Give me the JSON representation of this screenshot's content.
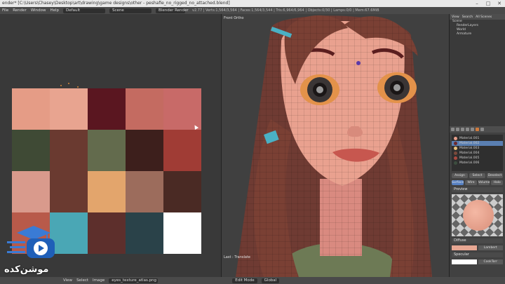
{
  "window": {
    "title": "ender* [C:\\Users\\Chasey\\Desktop\\art\\drawing\\game designs\\other - peshafie_no_rigged_no_attached.blend]"
  },
  "menubar": {
    "items": [
      "File",
      "Render",
      "Window",
      "Help"
    ],
    "layout_value": "Default",
    "scene_value": "Scene",
    "engine_value": "Blender Render",
    "stats": "v2.77 | Verts:1,564/3,564 | Faces:1,564/3,544 | Tris:6,964/6,964 | Objects:0/30 | Lamps:0/0 | Mem:67.6MiB"
  },
  "viewport": {
    "label": "Front Ortho",
    "last_operator": "Last : Translate"
  },
  "outliner": {
    "header": [
      "View",
      "Search",
      "All Scenes"
    ],
    "rows": [
      {
        "label": "Scene",
        "indent": 0
      },
      {
        "label": "RenderLayers",
        "indent": 1
      },
      {
        "label": "World",
        "indent": 1
      },
      {
        "label": "Armature",
        "indent": 1
      }
    ]
  },
  "properties": {
    "materials": [
      {
        "name": "Material.001",
        "color": "#e79e8b",
        "selected": false
      },
      {
        "name": "Material.002",
        "color": "#6d2a2d",
        "selected": true
      },
      {
        "name": "Material.003",
        "color": "#e7c07b",
        "selected": false
      },
      {
        "name": "Material.004",
        "color": "#7a4a3c",
        "selected": false
      },
      {
        "name": "Material.005",
        "color": "#a94a40",
        "selected": false
      },
      {
        "name": "Material.006",
        "color": "#3d4d3f",
        "selected": false
      }
    ],
    "buttons": [
      "Assign",
      "Select",
      "Deselect"
    ],
    "tabs": [
      "Surface",
      "Wire",
      "Volume",
      "Halo"
    ],
    "preview_label": "Preview",
    "diffuse_label": "Diffuse",
    "specular_label": "Specular",
    "lambert_label": "Lambert",
    "cooktorr_label": "CookTorr"
  },
  "palette": {
    "colors": [
      "#e59c86",
      "#e8a490",
      "#5a1620",
      "#c46b61",
      "#c86a68",
      "#3f4a35",
      "#6a3a30",
      "#636b4d",
      "#3d1f1c",
      "#a03c35",
      "#d99a8c",
      "#6a3a30",
      "#e3a56c",
      "#9c6c5c",
      "#4a2a24",
      "#b85a4a",
      "#4aa7b5",
      "#5d2f2c",
      "#2a4249",
      "#ffffff"
    ]
  },
  "logo": {
    "text": "موشن‌کده"
  },
  "statusbar": {
    "items": [
      "View",
      "Select",
      "Image"
    ],
    "image_value": "eyes_texture_atlas.png",
    "mode_value": "Edit Mode",
    "pivot_value": "Global"
  }
}
